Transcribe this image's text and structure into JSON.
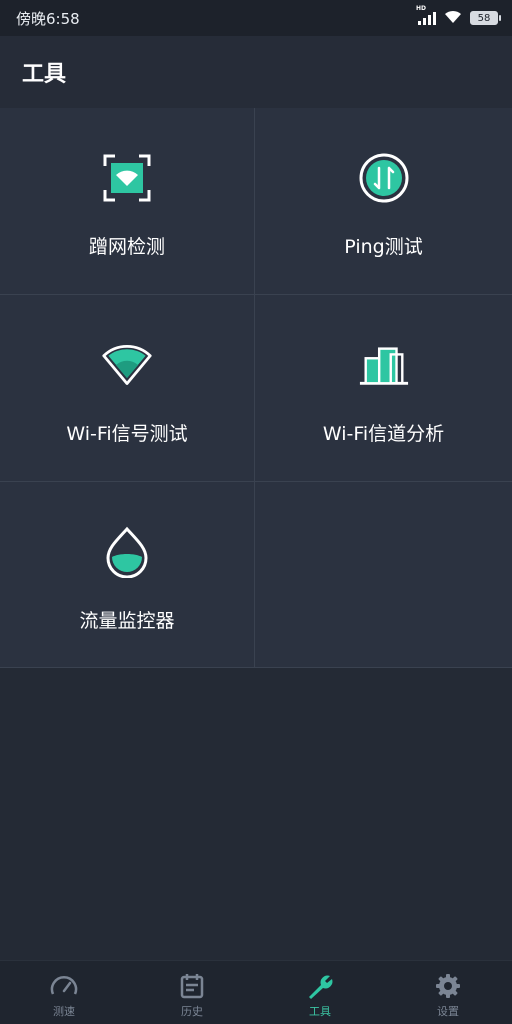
{
  "status_bar": {
    "time": "傍晚6:58",
    "network_label": "HD",
    "battery": "58",
    "icons": [
      "signal-icon",
      "wifi-icon",
      "battery-icon"
    ]
  },
  "header": {
    "title": "工具"
  },
  "tools": [
    {
      "label": "蹭网检测",
      "icon": "wifi-scan-icon"
    },
    {
      "label": "Ping测试",
      "icon": "ping-icon"
    },
    {
      "label": "Wi-Fi信号测试",
      "icon": "wifi-signal-icon"
    },
    {
      "label": "Wi-Fi信道分析",
      "icon": "channel-analysis-icon"
    },
    {
      "label": "流量监控器",
      "icon": "traffic-monitor-icon"
    }
  ],
  "bottom_nav": [
    {
      "label": "测速",
      "icon": "speedometer-icon",
      "active": false
    },
    {
      "label": "历史",
      "icon": "history-icon",
      "active": false
    },
    {
      "label": "工具",
      "icon": "wrench-icon",
      "active": true
    },
    {
      "label": "设置",
      "icon": "gear-icon",
      "active": false
    }
  ],
  "colors": {
    "accent": "#2ec6a2",
    "background": "#242a35",
    "panel": "#2b3240",
    "header": "#262c38",
    "nav_inactive": "#7b8594"
  }
}
